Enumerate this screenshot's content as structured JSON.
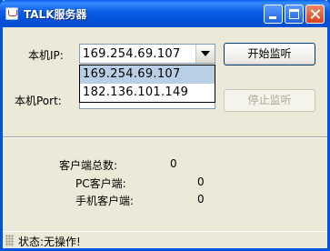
{
  "window": {
    "title": "TALK服务器"
  },
  "form": {
    "ip_label": "本机IP:",
    "ip_selected": "169.254.69.107",
    "ip_options": [
      "169.254.69.107",
      "182.136.101.149"
    ],
    "port_label": "本机Port:",
    "port_value": "",
    "start_button": "开始监听",
    "stop_button": "停止监听"
  },
  "stats": {
    "total_label": "客户端总数:",
    "total_value": "0",
    "pc_label": "PC客户端:",
    "pc_value": "0",
    "mobile_label": "手机客户端:",
    "mobile_value": "0"
  },
  "status": {
    "text": "状态:无操作!"
  },
  "colors": {
    "title_bar": "#0a5fe8",
    "window_bg": "#ece9d8",
    "selection": "#b8cfe5"
  }
}
